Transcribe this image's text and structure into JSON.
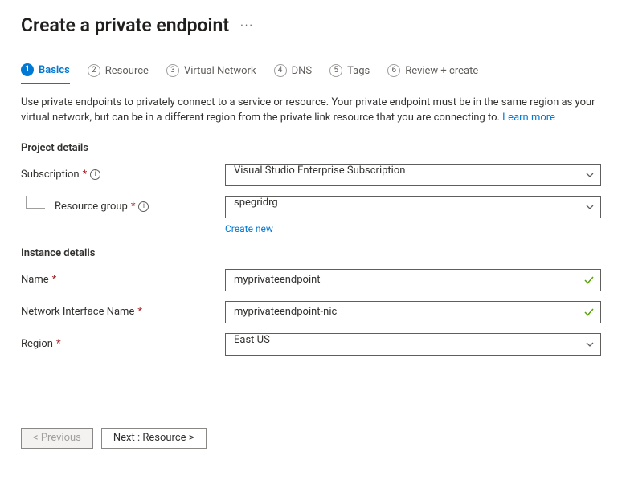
{
  "header": {
    "title": "Create a private endpoint"
  },
  "tabs": [
    {
      "num": "1",
      "label": "Basics",
      "active": true
    },
    {
      "num": "2",
      "label": "Resource"
    },
    {
      "num": "3",
      "label": "Virtual Network"
    },
    {
      "num": "4",
      "label": "DNS"
    },
    {
      "num": "5",
      "label": "Tags"
    },
    {
      "num": "6",
      "label": "Review + create"
    }
  ],
  "description": "Use private endpoints to privately connect to a service or resource. Your private endpoint must be in the same region as your virtual network, but can be in a different region from the private link resource that you are connecting to.  ",
  "learn_more": "Learn more",
  "project": {
    "title": "Project details",
    "subscription_label": "Subscription",
    "subscription_value": "Visual Studio Enterprise Subscription",
    "resource_group_label": "Resource group",
    "resource_group_value": "spegridrg",
    "create_new": "Create new"
  },
  "instance": {
    "title": "Instance details",
    "name_label": "Name",
    "name_value": "myprivateendpoint",
    "nic_label": "Network Interface Name",
    "nic_value": "myprivateendpoint-nic",
    "region_label": "Region",
    "region_value": "East US"
  },
  "footer": {
    "previous": "< Previous",
    "next": "Next : Resource >"
  }
}
